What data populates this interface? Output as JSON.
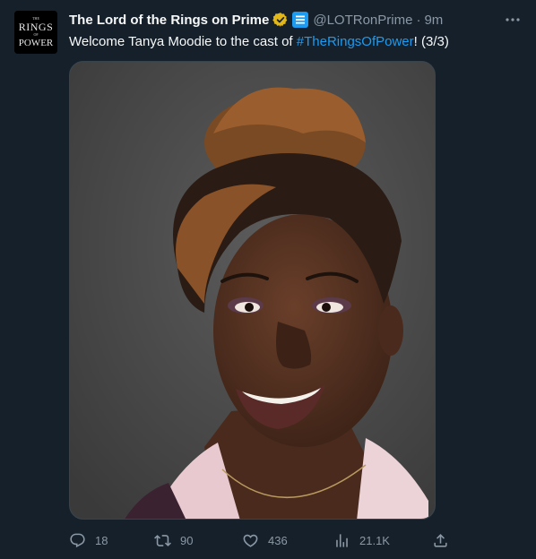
{
  "author": {
    "display_name": "The Lord of the Rings on Prime",
    "handle": "@LOTRonPrime",
    "separator": "·",
    "timestamp": "9m",
    "verified_badge_color": "#e2b719",
    "affiliate_badge_color": "#1d9bf0",
    "avatar_logo_lines": [
      "THE",
      "RINGS",
      "OF",
      "POWER"
    ]
  },
  "tweet": {
    "text_before": "Welcome Tanya Moodie to the cast of ",
    "hashtag": "#TheRingsOfPower",
    "text_after": "! (3/3)",
    "image_alt": "Portrait photo of Tanya Moodie smiling"
  },
  "actions": {
    "reply_count": "18",
    "retweet_count": "90",
    "like_count": "436",
    "views_count": "21.1K"
  },
  "icons": [
    "verified-icon",
    "affiliate-icon",
    "more-icon",
    "reply-icon",
    "retweet-icon",
    "like-icon",
    "views-icon",
    "share-icon"
  ],
  "colors": {
    "background": "#15202b",
    "text": "#f7f9f9",
    "muted": "#8b98a5",
    "link": "#1d9bf0"
  }
}
